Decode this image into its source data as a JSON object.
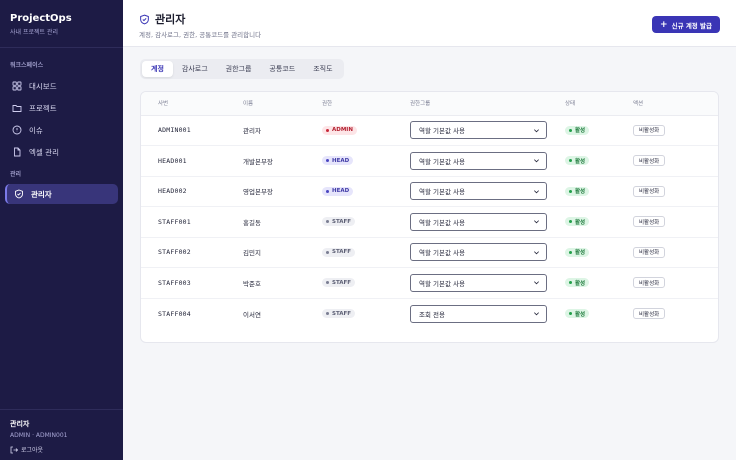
{
  "brand": {
    "title": "ProjectOps",
    "subtitle": "사내 프로젝트 관리"
  },
  "sidebar": {
    "workspace_label": "워크스페이스",
    "items": [
      {
        "label": "대시보드",
        "icon": "grid-icon"
      },
      {
        "label": "프로젝트",
        "icon": "folder-icon"
      },
      {
        "label": "이슈",
        "icon": "alert-circle-icon"
      },
      {
        "label": "엑셀 관리",
        "icon": "file-icon"
      }
    ],
    "admin_label": "관리",
    "admin_item": {
      "label": "관리자",
      "icon": "shield-icon"
    },
    "footer": {
      "name": "관리자",
      "role": "ADMIN · ADMIN001",
      "logout": "로그아웃"
    }
  },
  "header": {
    "title": "관리자",
    "subtitle": "계정, 감사로그, 권한, 공통코드를 관리합니다",
    "new_button": "신규 계정 발급"
  },
  "tabs": [
    "계정",
    "감사로그",
    "권한그룹",
    "공통코드",
    "조직도"
  ],
  "table": {
    "columns": [
      "사번",
      "이름",
      "권한",
      "권한그룹",
      "상태",
      "액션"
    ],
    "rows": [
      {
        "empno": "ADMIN001",
        "name": "관리자",
        "role": "ADMIN",
        "group": "역할 기본값 사용",
        "status": "활성",
        "action": "비활성화"
      },
      {
        "empno": "HEAD001",
        "name": "개발본부장",
        "role": "HEAD",
        "group": "역할 기본값 사용",
        "status": "활성",
        "action": "비활성화"
      },
      {
        "empno": "HEAD002",
        "name": "영업본부장",
        "role": "HEAD",
        "group": "역할 기본값 사용",
        "status": "활성",
        "action": "비활성화"
      },
      {
        "empno": "STAFF001",
        "name": "홍길동",
        "role": "STAFF",
        "group": "역할 기본값 사용",
        "status": "활성",
        "action": "비활성화"
      },
      {
        "empno": "STAFF002",
        "name": "김민지",
        "role": "STAFF",
        "group": "역할 기본값 사용",
        "status": "활성",
        "action": "비활성화"
      },
      {
        "empno": "STAFF003",
        "name": "박준호",
        "role": "STAFF",
        "group": "역할 기본값 사용",
        "status": "활성",
        "action": "비활성화"
      },
      {
        "empno": "STAFF004",
        "name": "이서연",
        "role": "STAFF",
        "group": "조회 전용",
        "status": "활성",
        "action": "비활성화"
      }
    ]
  },
  "colors": {
    "accent": "#3a35b5",
    "sidebar_bg": "#1d1b45",
    "admin": "#c8283a",
    "active": "#22a04a"
  }
}
